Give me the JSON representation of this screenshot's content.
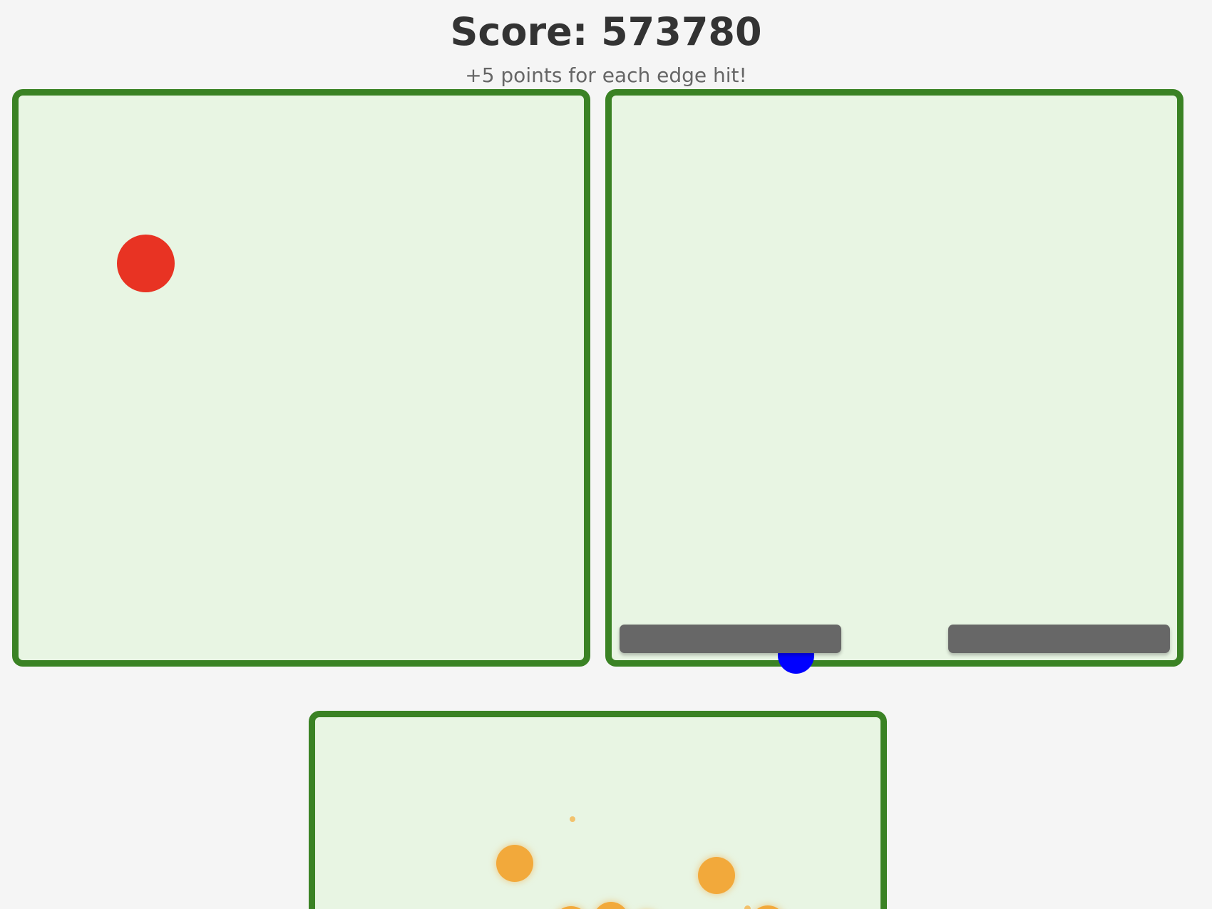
{
  "header": {
    "score_text": "Score: 573780",
    "hint_text": "+5 points for each edge hit!"
  },
  "colors": {
    "background": "#f5f5f5",
    "box_border": "#3a8224",
    "box_fill": "#e8f5e3",
    "red_ball": "#e83323",
    "blue_ball": "#0000ff",
    "paddle": "#676767",
    "orange_ball": "#f2a93b"
  },
  "game": {
    "boxes": [
      {
        "name": "box-left",
        "contents": [
          "red-ball"
        ]
      },
      {
        "name": "box-right",
        "contents": [
          "paddle-left",
          "paddle-right",
          "blue-ball"
        ]
      },
      {
        "name": "box-bottom",
        "contents": [
          "orange-balls",
          "sparks"
        ]
      }
    ]
  }
}
